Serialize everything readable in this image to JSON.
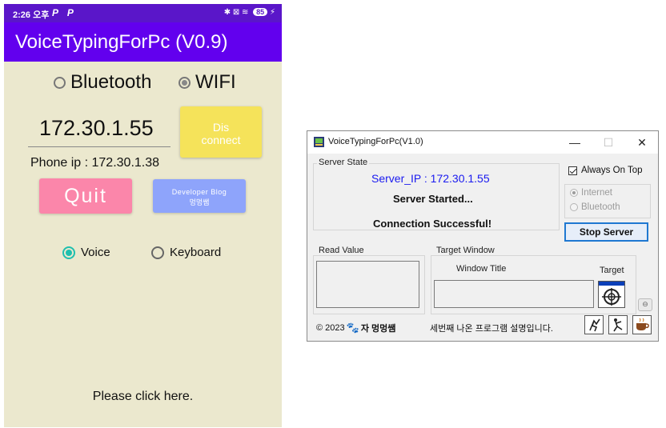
{
  "phone": {
    "status": {
      "time": "2:26 오후",
      "notif": "P P",
      "icons": "✱ ⊠ ≋",
      "battery": "85",
      "charging": "⚡"
    },
    "app_title": "VoiceTypingForPc (V0.9)",
    "conn_options": [
      {
        "label": "Bluetooth",
        "selected": false
      },
      {
        "label": "WIFI",
        "selected": true
      }
    ],
    "ip_value": "172.30.1.55",
    "phone_ip": "Phone ip : 172.30.1.38",
    "disconnect_btn": {
      "line1": "Dis",
      "line2": "connect"
    },
    "quit_btn": "Quit",
    "dev_btn": {
      "line1": "Developer Blog",
      "line2": "멍멍쌤"
    },
    "mode_options": [
      {
        "label": "Voice",
        "selected": true
      },
      {
        "label": "Keyboard",
        "selected": false
      }
    ],
    "hint": "Please click here.",
    "colors": {
      "statusbar": "#5a16c9",
      "appbar": "#6200ee",
      "background": "#ebe8ce",
      "disconnect": "#f5e35a",
      "quit": "#fb86aa",
      "dev": "#8ea4fb",
      "radio_accent": "#1fbfae"
    }
  },
  "window": {
    "title": "VoiceTypingForPc(V1.0)",
    "controls": {
      "minimize": "—",
      "maximize": "☐",
      "close": "✕"
    },
    "server_state": {
      "label": "Server State",
      "server_ip": "Server_IP : 172.30.1.55",
      "status": "Server Started...",
      "connection": "Connection Successful!"
    },
    "always_on_top": {
      "label": "Always On Top",
      "checked": true
    },
    "transport": [
      {
        "label": "Internet",
        "selected": true,
        "enabled": false
      },
      {
        "label": "Bluetooth",
        "selected": false,
        "enabled": false
      }
    ],
    "stop_button": "Stop Server",
    "read_value_label": "Read Value",
    "target_window": {
      "label": "Target Window",
      "window_title_label": "Window Title",
      "target_label": "Target"
    },
    "footer": {
      "copyright": "© 2023",
      "brand_prefix": "자",
      "brand": "멍멍쌤",
      "description": "세번째 나온 프로그램 설명입니다."
    },
    "icons": [
      "writer-figure-icon",
      "jump-figure-icon",
      "coffee-cup-icon"
    ],
    "colors": {
      "server_ip": "#1a1af0",
      "button_border": "#1f78d1"
    }
  }
}
